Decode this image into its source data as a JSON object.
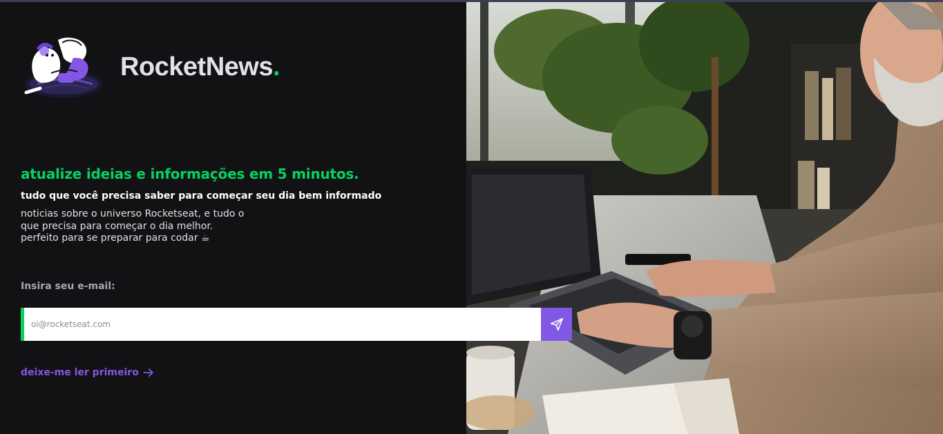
{
  "brand": {
    "name": "RocketNews",
    "dot": "."
  },
  "hero": {
    "headline": "atualize ideias e informações em 5 minutos.",
    "subheadline": "tudo que você precisa saber para começar seu dia bem informado",
    "description_lines": [
      "noticias sobre o universo Rocketseat, e tudo o",
      "que precisa para começar o dia melhor.",
      "perfeito para se preparar para codar ☕"
    ]
  },
  "form": {
    "email_label": "Insira seu e-mail:",
    "email_placeholder": "oi@rocketseat.com",
    "email_value": "",
    "submit_icon": "send-icon"
  },
  "link": {
    "read_first_label": "deixe-me ler primeiro",
    "icon": "arrow-right-icon"
  },
  "colors": {
    "background": "#121214",
    "accent_green": "#04d361",
    "accent_purple": "#8257e5",
    "text": "#e1e1e6",
    "muted": "#a8a8b3"
  }
}
